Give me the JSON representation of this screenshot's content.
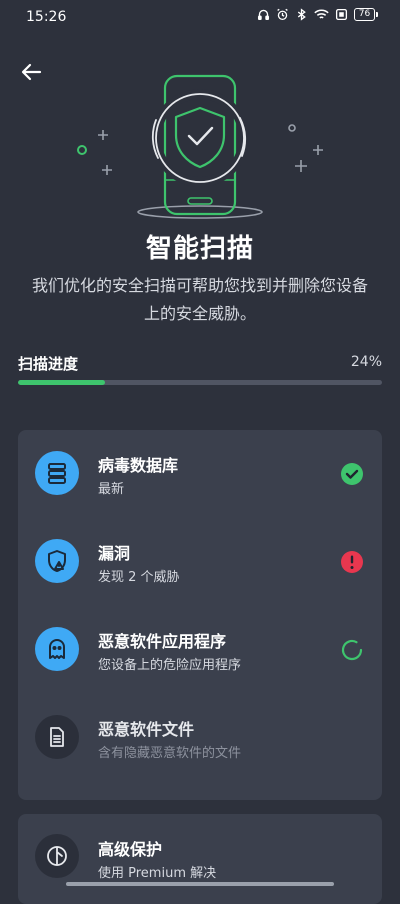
{
  "status_bar": {
    "time": "15:26",
    "battery": "76",
    "icons": [
      "headphones-icon",
      "alarm-icon",
      "bluetooth-icon",
      "wifi-icon",
      "screen-icon",
      "battery-icon"
    ]
  },
  "header": {
    "back_icon": "arrow-left-icon"
  },
  "hero": {
    "icon": "phone-shield-check-illustration",
    "accent_color": "#3ec46d"
  },
  "title": "智能扫描",
  "description": "我们优化的安全扫描可帮助您找到并删除您设备上的安全威胁。",
  "progress": {
    "label": "扫描进度",
    "value_text": "24%",
    "fraction": 0.24,
    "color": "#3ec46d"
  },
  "scan_items": [
    {
      "title": "病毒数据库",
      "subtitle": "最新",
      "icon": "database-icon",
      "status": "done",
      "status_color": "#3ec46d"
    },
    {
      "title": "漏洞",
      "subtitle": "发现 2 个威胁",
      "icon": "shield-warning-icon",
      "status": "threat",
      "status_color": "#e8374f"
    },
    {
      "title": "恶意软件应用程序",
      "subtitle": "您设备上的危险应用程序",
      "icon": "ghost-icon",
      "status": "scanning",
      "status_color": "#3ec46d"
    },
    {
      "title": "恶意软件文件",
      "subtitle": "含有隐藏恶意软件的文件",
      "icon": "file-icon",
      "status": "pending"
    }
  ],
  "premium": {
    "title": "高级保护",
    "subtitle": "使用 Premium 解决",
    "icon": "premium-shield-icon"
  }
}
